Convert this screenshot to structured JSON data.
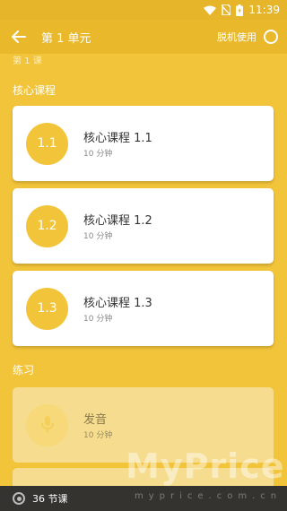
{
  "status_bar": {
    "time": "11:39"
  },
  "app_bar": {
    "title": "第 1 单元",
    "offline_label": "脱机使用"
  },
  "partial_text": "第 1 课",
  "sections": {
    "core": "核心课程",
    "practice": "练习"
  },
  "lessons": [
    {
      "badge": "1.1",
      "title": "核心课程 1.1",
      "duration": "10 分钟"
    },
    {
      "badge": "1.2",
      "title": "核心课程 1.2",
      "duration": "10 分钟"
    },
    {
      "badge": "1.3",
      "title": "核心课程 1.3",
      "duration": "10 分钟"
    }
  ],
  "practice_items": [
    {
      "title": "发音",
      "duration": "10 分钟",
      "icon": "mic-icon"
    }
  ],
  "bottom_bar": {
    "label": "36 节课"
  },
  "watermark": {
    "brand": "MyPrice",
    "domain": "myprice.com.cn"
  }
}
